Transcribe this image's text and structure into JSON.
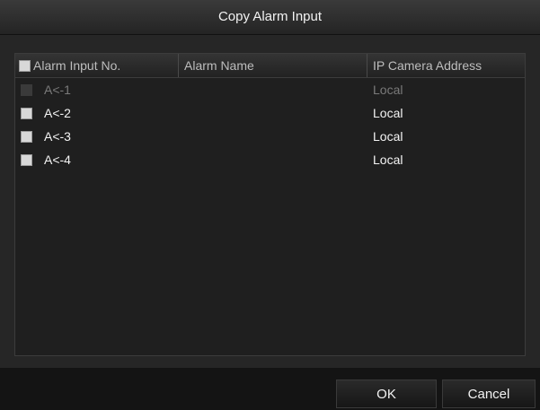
{
  "dialog": {
    "title": "Copy Alarm Input"
  },
  "table": {
    "columns": [
      "Alarm Input No.",
      "Alarm Name",
      "IP Camera Address"
    ],
    "rows": [
      {
        "number": "A<-1",
        "name": "",
        "address": "Local",
        "enabled": false,
        "checked": false
      },
      {
        "number": "A<-2",
        "name": "",
        "address": "Local",
        "enabled": true,
        "checked": false
      },
      {
        "number": "A<-3",
        "name": "",
        "address": "Local",
        "enabled": true,
        "checked": false
      },
      {
        "number": "A<-4",
        "name": "",
        "address": "Local",
        "enabled": true,
        "checked": false
      }
    ]
  },
  "buttons": {
    "ok": "OK",
    "cancel": "Cancel"
  }
}
